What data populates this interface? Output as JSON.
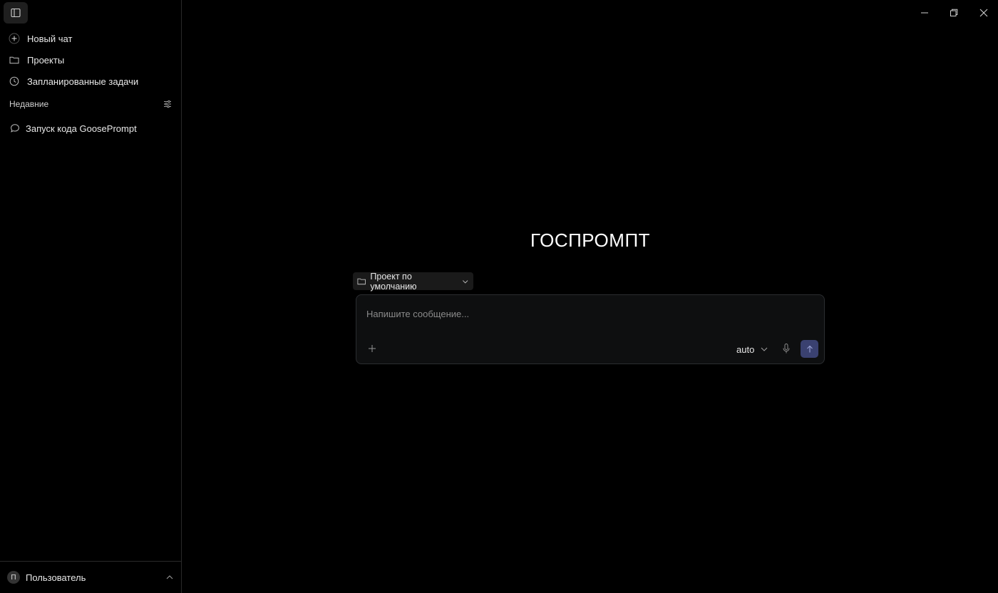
{
  "sidebar": {
    "nav": [
      {
        "label": "Новый чат",
        "icon": "plus-icon"
      },
      {
        "label": "Проекты",
        "icon": "folder-icon"
      },
      {
        "label": "Запланированные задачи",
        "icon": "clock-icon"
      }
    ],
    "recent_label": "Недавние",
    "recent_items": [
      {
        "label": "Запуск кода GoosePrompt",
        "icon": "chat-bubble-icon"
      }
    ],
    "user": {
      "initial": "П",
      "name": "Пользователь"
    }
  },
  "main": {
    "brand_title": "ГОСПРОМПТ",
    "project_select": {
      "value": "Проект по умолчанию"
    },
    "composer": {
      "placeholder": "Напишите сообщение...",
      "model": "auto"
    }
  },
  "colors": {
    "background": "#000000",
    "accent_send": "#3a4170"
  }
}
